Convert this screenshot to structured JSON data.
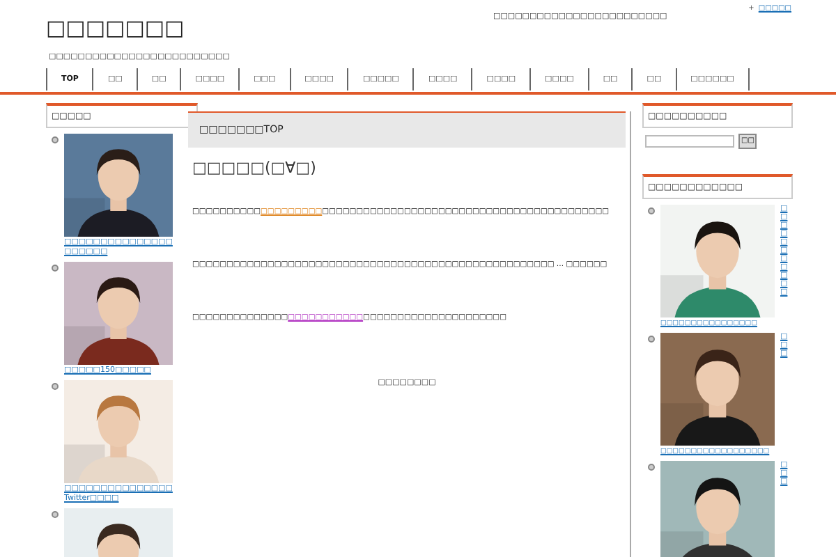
{
  "top_link": {
    "mark": "+",
    "label": "□□□□□"
  },
  "site": {
    "title": "□□□□□□□",
    "tagline": "□□□□□□□□□□□□□□□□□□□□□□□□□",
    "notice": "□□□□□□□□□□□□□□□□□□□□□□□□"
  },
  "nav": [
    {
      "label": "TOP",
      "selected": true
    },
    {
      "label": "□□",
      "selected": false
    },
    {
      "label": "□□",
      "selected": false
    },
    {
      "label": "□□□□",
      "selected": false
    },
    {
      "label": "□□□",
      "selected": false
    },
    {
      "label": "□□□□",
      "selected": false
    },
    {
      "label": "□□□□□",
      "selected": false
    },
    {
      "label": "□□□□",
      "selected": false
    },
    {
      "label": "□□□□",
      "selected": false
    },
    {
      "label": "□□□□",
      "selected": false
    },
    {
      "label": "□□",
      "selected": false
    },
    {
      "label": "□□",
      "selected": false
    },
    {
      "label": "□□□□□□",
      "selected": false
    }
  ],
  "left_sidebar": {
    "title": "□□□□□",
    "items": [
      {
        "kind": "picture",
        "link": "□□□□□□□□□□□□□□□□□□□□□"
      },
      {
        "kind": "picture",
        "link": "□□□□□150□□□□□"
      },
      {
        "kind": "picture",
        "link": "□□□□□□□□□□□□□□□Twitter□□□□"
      },
      {
        "kind": "picture"
      }
    ]
  },
  "main": {
    "breadcrumb": "□□□□□□□TOP",
    "heading": "□□□□□(□∀□)",
    "paragraphs": [
      [
        {
          "kind": "text",
          "text": "□□□□□□□□□□"
        },
        {
          "kind": "link",
          "text": "□□□□□□□□□",
          "color": "#e08a2a"
        },
        {
          "kind": "text",
          "text": "□□□□□□□□□□□□□□□□□□□□□□□□□□□□□□□□□□□□□□□□□□"
        }
      ],
      [
        {
          "kind": "text",
          "text": "□□□□□□□□□□□□□□□□□□□□□□□□□□□□□□□□□□□□□□□□□□□□□□□□□□□□□ … □□□□□□"
        }
      ],
      [
        {
          "kind": "text",
          "text": "□□□□□□□□□□□□□□"
        },
        {
          "kind": "link",
          "text": "□□□□□□□□□□□",
          "color": "#b030c0"
        },
        {
          "kind": "text",
          "text": "□□□□□□□□□□□□□□□□□□□□□"
        }
      ]
    ],
    "footer_note": "□□□□□□□□"
  },
  "right_sidebar": {
    "search_title": "□□□□□□□□□□",
    "search_button": "□□",
    "list_title": "□□□□□□□□□□□□",
    "items": [
      {
        "kind": "picture",
        "side_text": "□□□□□□□□□□□",
        "link": "□□□□□□□□□□□□□□□□"
      },
      {
        "kind": "picture",
        "side_text": "□□□",
        "link": "□□□□□□□□□□□□□□□□□□"
      },
      {
        "kind": "picture",
        "side_text": "□□□"
      }
    ]
  }
}
